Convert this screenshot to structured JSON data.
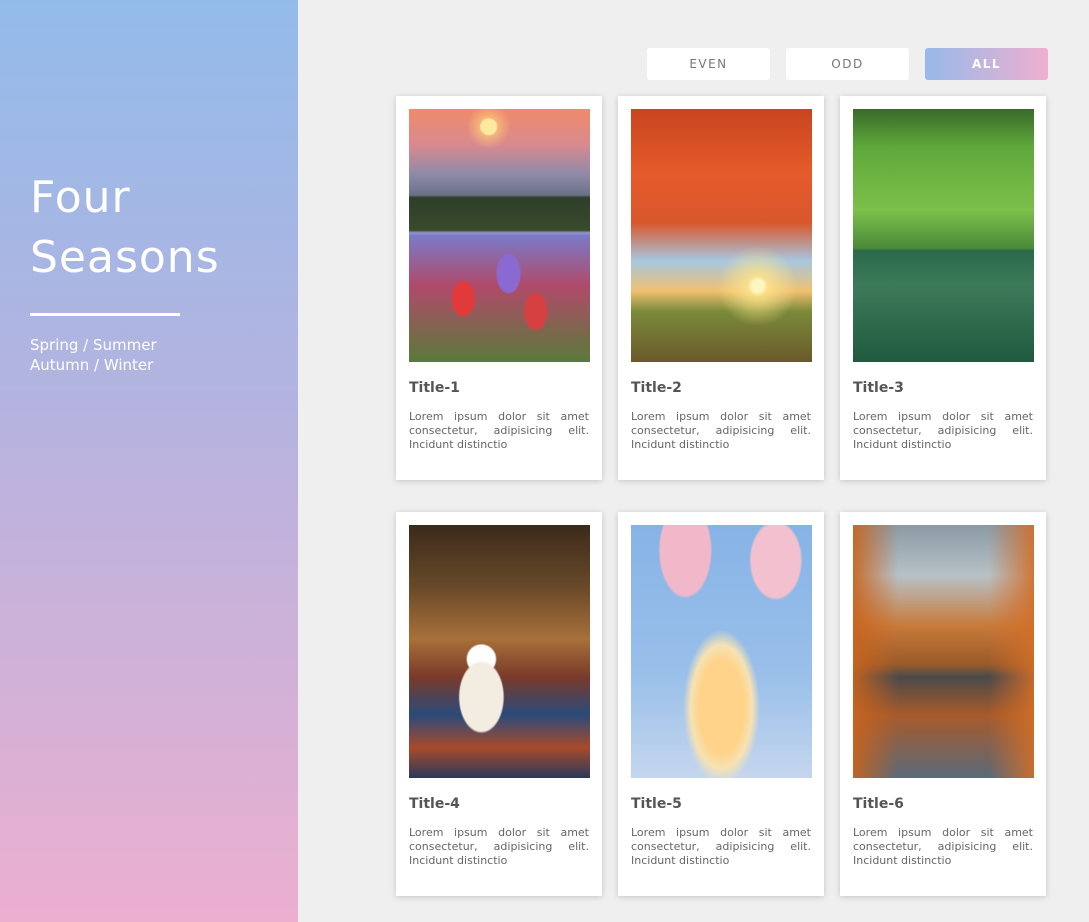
{
  "sidebar": {
    "title": "Four Seasons",
    "subtitle_line1": "Spring / Summer",
    "subtitle_line2": "Autumn / Winter"
  },
  "filters": {
    "even": "EVEN",
    "odd": "ODD",
    "all": "ALL",
    "active": "ALL"
  },
  "cards": [
    {
      "title": "Title-1",
      "text": "Lorem ipsum dolor sit amet consectetur, adipisicing elit. Incidunt distinctio",
      "image": "spring-wildflowers-sunset"
    },
    {
      "title": "Title-2",
      "text": "Lorem ipsum dolor sit amet consectetur, adipisicing elit. Incidunt distinctio",
      "image": "autumn-tree-sunburst"
    },
    {
      "title": "Title-3",
      "text": "Lorem ipsum dolor sit amet consectetur, adipisicing elit. Incidunt distinctio",
      "image": "green-hills-lake"
    },
    {
      "title": "Title-4",
      "text": "Lorem ipsum dolor sit amet consectetur, adipisicing elit. Incidunt distinctio",
      "image": "autumn-picnic-book-coffee"
    },
    {
      "title": "Title-5",
      "text": "Lorem ipsum dolor sit amet consectetur, adipisicing elit. Incidunt distinctio",
      "image": "cherry-blossom-clouds"
    },
    {
      "title": "Title-6",
      "text": "Lorem ipsum dolor sit amet consectetur, adipisicing elit. Incidunt distinctio",
      "image": "autumn-canal-city"
    }
  ],
  "colors": {
    "sidebar_top": "#93bbea",
    "sidebar_bottom": "#ecafcf",
    "background": "#efefef",
    "active_gradient_start": "#97b9ea",
    "active_gradient_end": "#eeb0cf"
  }
}
